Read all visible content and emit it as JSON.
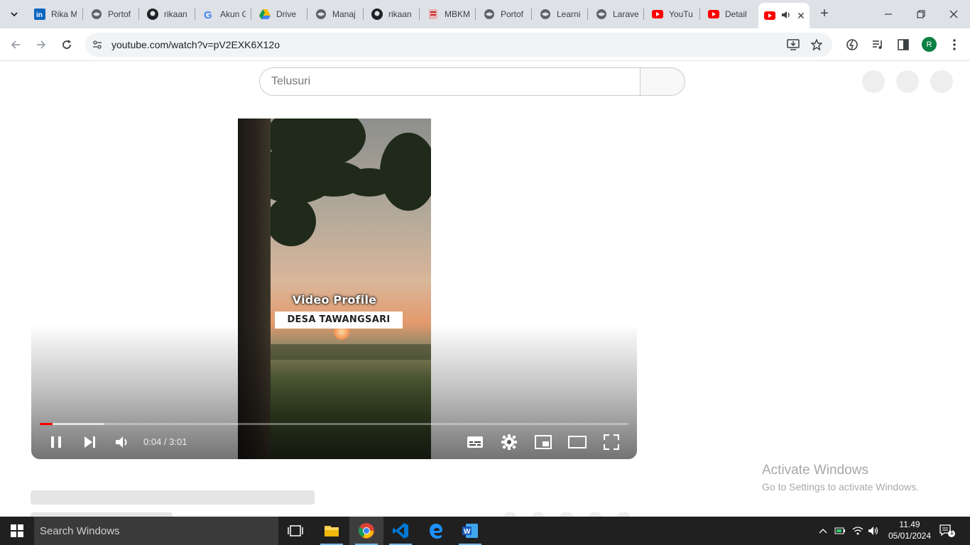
{
  "browser": {
    "tabs": [
      {
        "label": "Rika M",
        "icon": "linkedin-icon"
      },
      {
        "label": "Portof",
        "icon": "globe-icon"
      },
      {
        "label": "rikaan",
        "icon": "github-icon"
      },
      {
        "label": "Akun G",
        "icon": "google-icon"
      },
      {
        "label": "Drive",
        "icon": "drive-icon"
      },
      {
        "label": "Manaj",
        "icon": "globe-icon"
      },
      {
        "label": "rikaan",
        "icon": "github-icon"
      },
      {
        "label": "MBKM",
        "icon": "mbkm-icon"
      },
      {
        "label": "Portof",
        "icon": "globe-icon"
      },
      {
        "label": "Learni",
        "icon": "globe-icon"
      },
      {
        "label": "Larave",
        "icon": "globe-icon"
      },
      {
        "label": "YouTu",
        "icon": "youtube-icon"
      },
      {
        "label": "Detail",
        "icon": "youtube-icon"
      }
    ],
    "active_tab": {
      "icon": "youtube-icon",
      "audio": "speaker-icon"
    },
    "url": "youtube.com/watch?v=pV2EXK6X12o",
    "profile_initial": "R"
  },
  "youtube": {
    "search_placeholder": "Telusuri",
    "video": {
      "overlay_title": "Video Profile",
      "overlay_subtitle": "DESA TAWANGSARI",
      "time_display": "0:04 / 3:01",
      "played_fraction": 0.022,
      "loaded_fraction": 0.11
    }
  },
  "watermark": {
    "line1": "Activate Windows",
    "line2": "Go to Settings to activate Windows."
  },
  "taskbar": {
    "search_placeholder": "Search Windows",
    "time": "11.49",
    "date": "05/01/2024",
    "notification_count": "1"
  },
  "colors": {
    "tabstrip": "#dee1e6",
    "youtube_red": "#ff0000",
    "taskbar": "#202020",
    "accent": "#76b9ed"
  }
}
